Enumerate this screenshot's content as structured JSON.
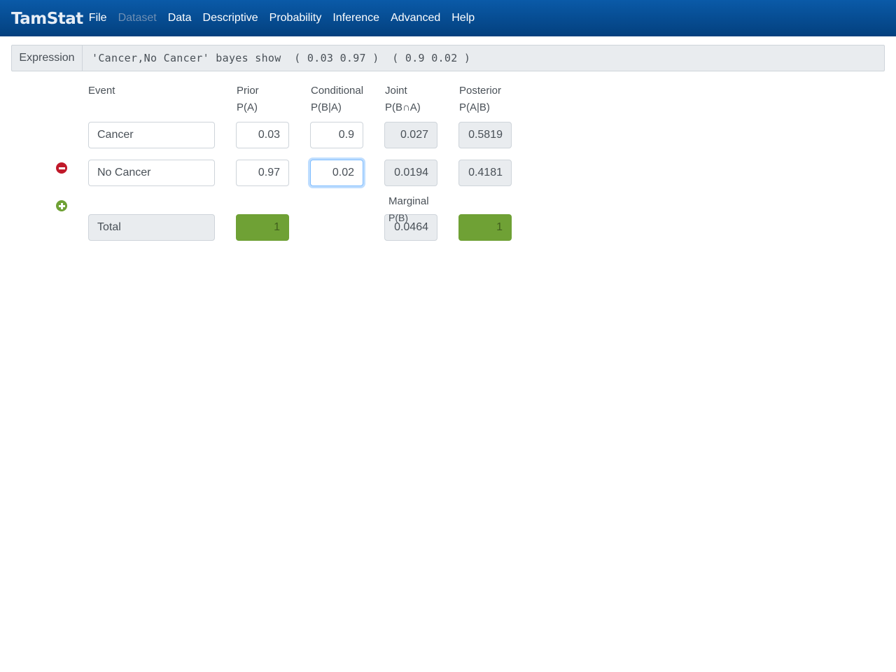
{
  "navbar": {
    "brand": "TamStat",
    "items": [
      {
        "label": "File",
        "disabled": false
      },
      {
        "label": "Dataset",
        "disabled": true
      },
      {
        "label": "Data",
        "disabled": false
      },
      {
        "label": "Descriptive",
        "disabled": false
      },
      {
        "label": "Probability",
        "disabled": false
      },
      {
        "label": "Inference",
        "disabled": false
      },
      {
        "label": "Advanced",
        "disabled": false
      },
      {
        "label": "Help",
        "disabled": false
      }
    ]
  },
  "expression": {
    "label": "Expression",
    "value": "'Cancer,No Cancer' bayes show  ( 0.03 0.97 )  ( 0.9 0.02 )"
  },
  "table": {
    "headers": {
      "event": "Event",
      "prior": "Prior",
      "prior_sub": "P(A)",
      "conditional": "Conditional",
      "conditional_sub": "P(B|A)",
      "joint": "Joint",
      "joint_sub": "P(B∩A)",
      "posterior": "Posterior",
      "posterior_sub": "P(A|B)"
    },
    "rows": [
      {
        "event": "Cancer",
        "prior": "0.03",
        "conditional": "0.9",
        "joint": "0.027",
        "posterior": "0.5819"
      },
      {
        "event": "No Cancer",
        "prior": "0.97",
        "conditional": "0.02",
        "joint": "0.0194",
        "posterior": "0.4181"
      }
    ],
    "icons": {
      "remove": "minus-circle-icon",
      "add": "plus-circle-icon"
    },
    "total": {
      "label": "Total",
      "prior_sum": "1",
      "marginal_label": "Marginal",
      "marginal_sub": "P(B)",
      "marginal_value": "0.0464",
      "posterior_sum": "1"
    }
  },
  "colors": {
    "navbar": "#03407e",
    "valid_sum": "#6fa135",
    "remove": "#c0192a",
    "add": "#6fa135"
  }
}
